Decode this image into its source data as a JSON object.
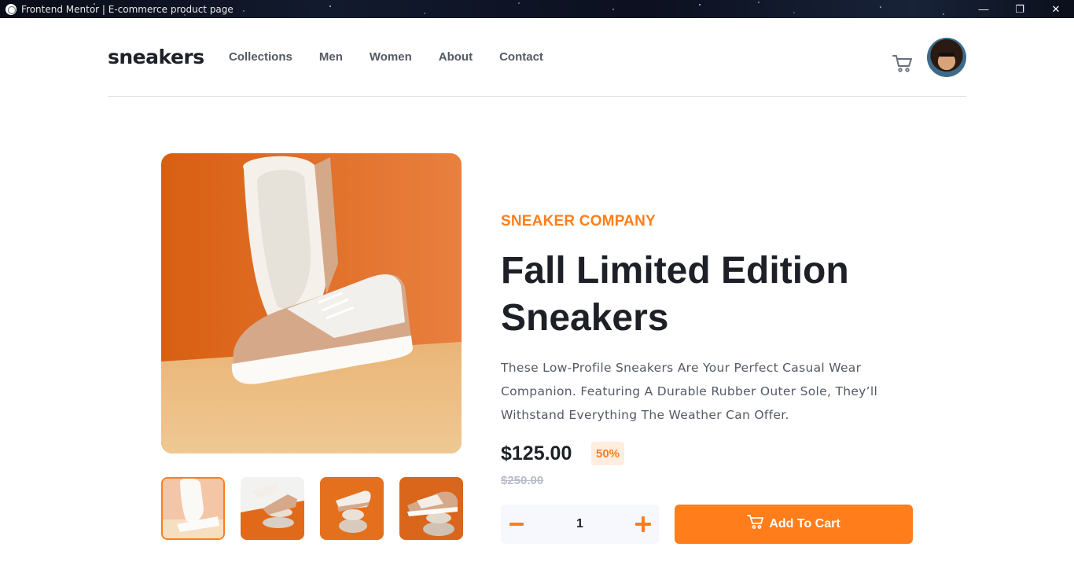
{
  "window": {
    "title": "Frontend Mentor | E-commerce product page",
    "controls": {
      "minimize": "—",
      "restore": "❐",
      "close": "✕"
    }
  },
  "header": {
    "logo": "sneakers",
    "nav": [
      "Collections",
      "Men",
      "Women",
      "About",
      "Contact"
    ],
    "cart_icon": "cart-icon",
    "avatar": "user-avatar"
  },
  "product": {
    "company": "SNEAKER COMPANY",
    "title": "Fall Limited Edition Sneakers",
    "description": "These Low-Profile Sneakers Are Your Perfect Casual Wear Companion. Featuring A Durable Rubber Outer Sole, They’ll Withstand Everything The Weather Can Offer.",
    "price": "$125.00",
    "discount": "50%",
    "original_price": "$250.00",
    "quantity": "1",
    "minus_label": "−",
    "plus_label": "+",
    "add_to_cart": "Add To Cart",
    "active_thumbnail": 1,
    "thumbnail_count": 4
  },
  "colors": {
    "accent": "#ff7e1b",
    "accent_pale": "#ffede0",
    "text_dark": "#1d2026",
    "text_muted": "#545964",
    "text_light": "#b6bcc8",
    "qty_bg": "#f6f8fd"
  }
}
